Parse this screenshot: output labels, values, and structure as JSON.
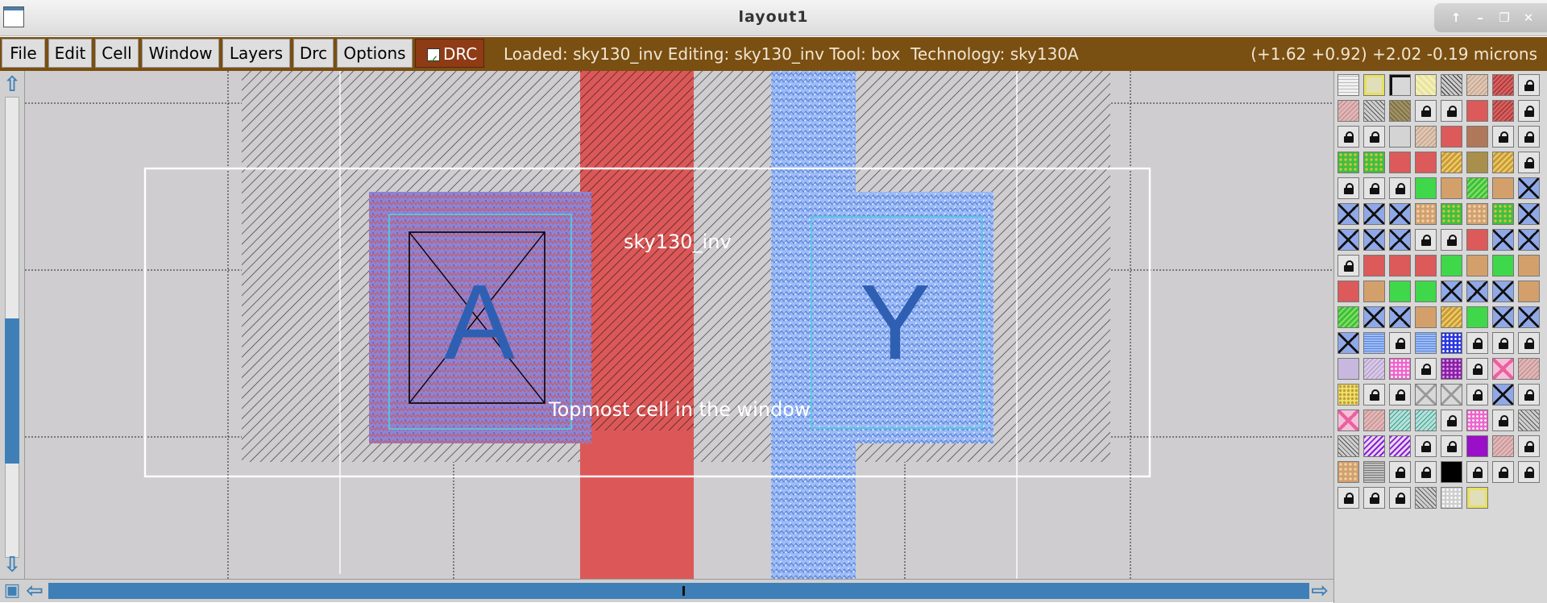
{
  "window": {
    "title": "layout1",
    "icons": [
      "maximize-arrow-icon",
      "minimize-icon",
      "restore-icon",
      "close-icon"
    ]
  },
  "menu": [
    "File",
    "Edit",
    "Cell",
    "Window",
    "Layers",
    "Drc",
    "Options"
  ],
  "drc": {
    "label": "DRC",
    "checked": true
  },
  "status": {
    "text": "Loaded: sky130_inv Editing: sky130_inv Tool: box  Technology: sky130A",
    "coords": "(+1.62 +0.92) +2.02 -0.19 microns"
  },
  "layout": {
    "cell_name": "sky130_inv",
    "cell_label": "Topmost cell in the window",
    "ports": [
      "A",
      "Y"
    ]
  },
  "colors": {
    "menubar": "#7a4f12",
    "poly": "#dc5858",
    "metal": "#9dbcf7",
    "port": "#2f5fb2",
    "selection_box": "#ffffff",
    "scroll": "#3f7fb7"
  },
  "palette": {
    "rows": [
      [
        "pattern",
        "yellow-frame",
        "outline",
        "yellow-x",
        "hatch",
        "tan-hatch",
        "red-hatch",
        "lock"
      ],
      [
        "pink-hatch",
        "gray-hatch",
        "olive-hatch",
        "lock",
        "lock",
        "red",
        "red-hatch",
        "lock"
      ],
      [
        "lock",
        "lock",
        "gray",
        "tan-hatch",
        "red",
        "brown",
        "lock",
        "lock"
      ],
      [
        "green-dots",
        "green-dots",
        "red",
        "red",
        "yellow-stripe",
        "olive",
        "yellow-stripe",
        "lock"
      ],
      [
        "lock",
        "lock",
        "lock",
        "green",
        "tan",
        "green-stripe",
        "tan",
        "cross"
      ],
      [
        "cross",
        "cross",
        "cross",
        "tan-dots",
        "green-dots",
        "tan-dots",
        "green-dots",
        "cross"
      ],
      [
        "cross",
        "cross",
        "cross",
        "lock",
        "lock",
        "red",
        "cross",
        "cross"
      ],
      [
        "lock",
        "red",
        "red",
        "red",
        "green",
        "tan",
        "green",
        "tan"
      ],
      [
        "red",
        "tan",
        "green",
        "green",
        "cross",
        "cross",
        "cross",
        "tan"
      ],
      [
        "green-stripe",
        "cross",
        "cross",
        "tan",
        "yellow-stripe",
        "green",
        "cross",
        "cross"
      ],
      [
        "cross",
        "blue-wave",
        "lock",
        "blue-wave",
        "blue-dots",
        "lock",
        "lock",
        "lock"
      ],
      [
        "lavender",
        "lavender-hatch",
        "pink-dots",
        "lock",
        "purple-dots",
        "lock",
        "pink-cross",
        "pink-hatch"
      ],
      [
        "yellow-dots",
        "lock",
        "lock",
        "gray-cross",
        "gray-cross",
        "lock",
        "cross",
        "lock"
      ],
      [
        "pink-cross",
        "pink-hatch",
        "teal-hatch",
        "teal-hatch",
        "lock",
        "pink-dots",
        "lock",
        "gray-hatch"
      ],
      [
        "gray-hatch",
        "purple-hatch",
        "purple-hatch",
        "lock",
        "lock",
        "purple",
        "pink-hatch",
        "lock"
      ],
      [
        "tan-dots",
        "gray-wave",
        "lock",
        "lock",
        "black",
        "lock",
        "lock",
        "lock"
      ],
      [
        "lock",
        "lock",
        "lock",
        "gray-hatch",
        "white-dots",
        "yellow-frame"
      ]
    ]
  }
}
